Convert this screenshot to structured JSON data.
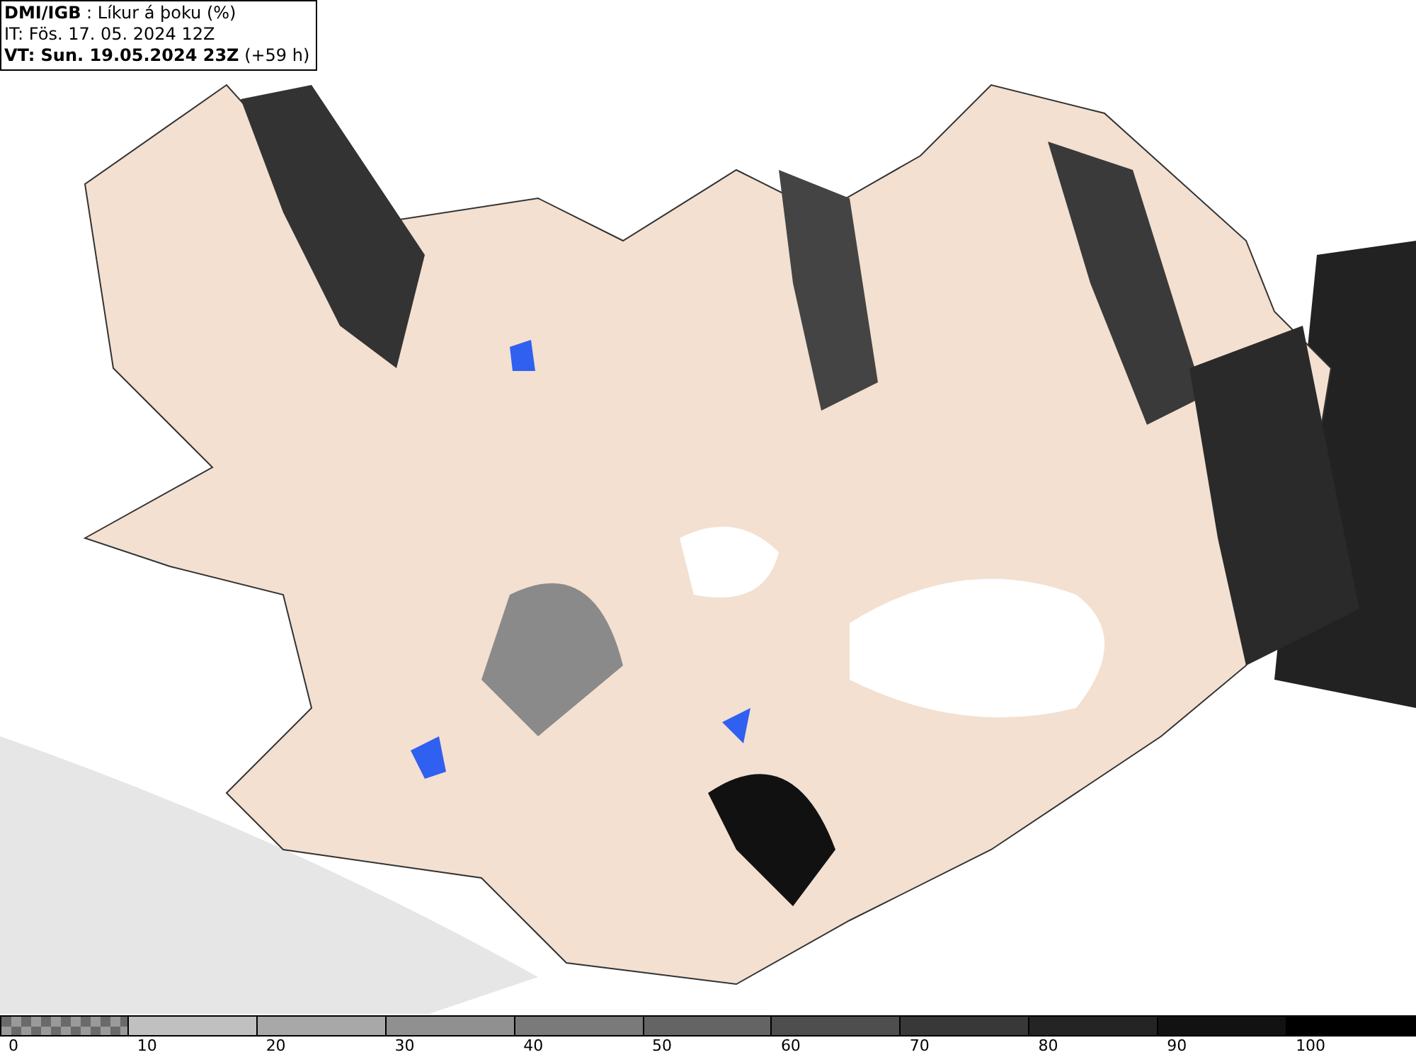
{
  "header": {
    "lines": [
      "**DMI/IGB** : Líkur á þoku (%)",
      "IT: Fös. 17. 05. 2024 12Z",
      "**VT: Sun. 19.05.2024 23Z** (+59 h)"
    ]
  },
  "legend": {
    "segments": [
      {
        "kind": "checker",
        "color": "#9a9a9a",
        "label": "0"
      },
      {
        "kind": "solid",
        "color": "#c0c0c0",
        "label": "10"
      },
      {
        "kind": "solid",
        "color": "#a8a8a8",
        "label": "20"
      },
      {
        "kind": "solid",
        "color": "#909090",
        "label": "30"
      },
      {
        "kind": "solid",
        "color": "#7a7a7a",
        "label": "40"
      },
      {
        "kind": "solid",
        "color": "#646464",
        "label": "50"
      },
      {
        "kind": "solid",
        "color": "#4e4e4e",
        "label": "60"
      },
      {
        "kind": "solid",
        "color": "#383838",
        "label": "70"
      },
      {
        "kind": "solid",
        "color": "#242424",
        "label": "80"
      },
      {
        "kind": "solid",
        "color": "#121212",
        "label": "90"
      },
      {
        "kind": "solid",
        "color": "#000000",
        "label": "100"
      }
    ]
  }
}
